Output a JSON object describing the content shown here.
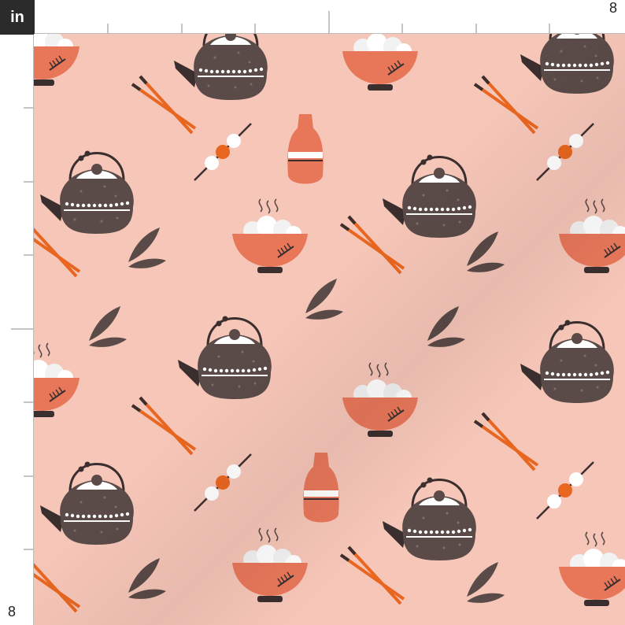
{
  "ruler": {
    "unit_label": "in",
    "top_end_label": "8",
    "left_end_label": "8"
  },
  "pattern": {
    "background_color": "#f6c6b8",
    "teapot_color": "#5a4a48",
    "accent_color": "#e8775a",
    "orange_color": "#e8661f",
    "white_color": "#ffffff",
    "icons": [
      "teapot-icon",
      "rice-bowl-icon",
      "chopsticks-icon",
      "dango-skewer-icon",
      "sake-bottle-icon",
      "leaf-icon"
    ]
  }
}
